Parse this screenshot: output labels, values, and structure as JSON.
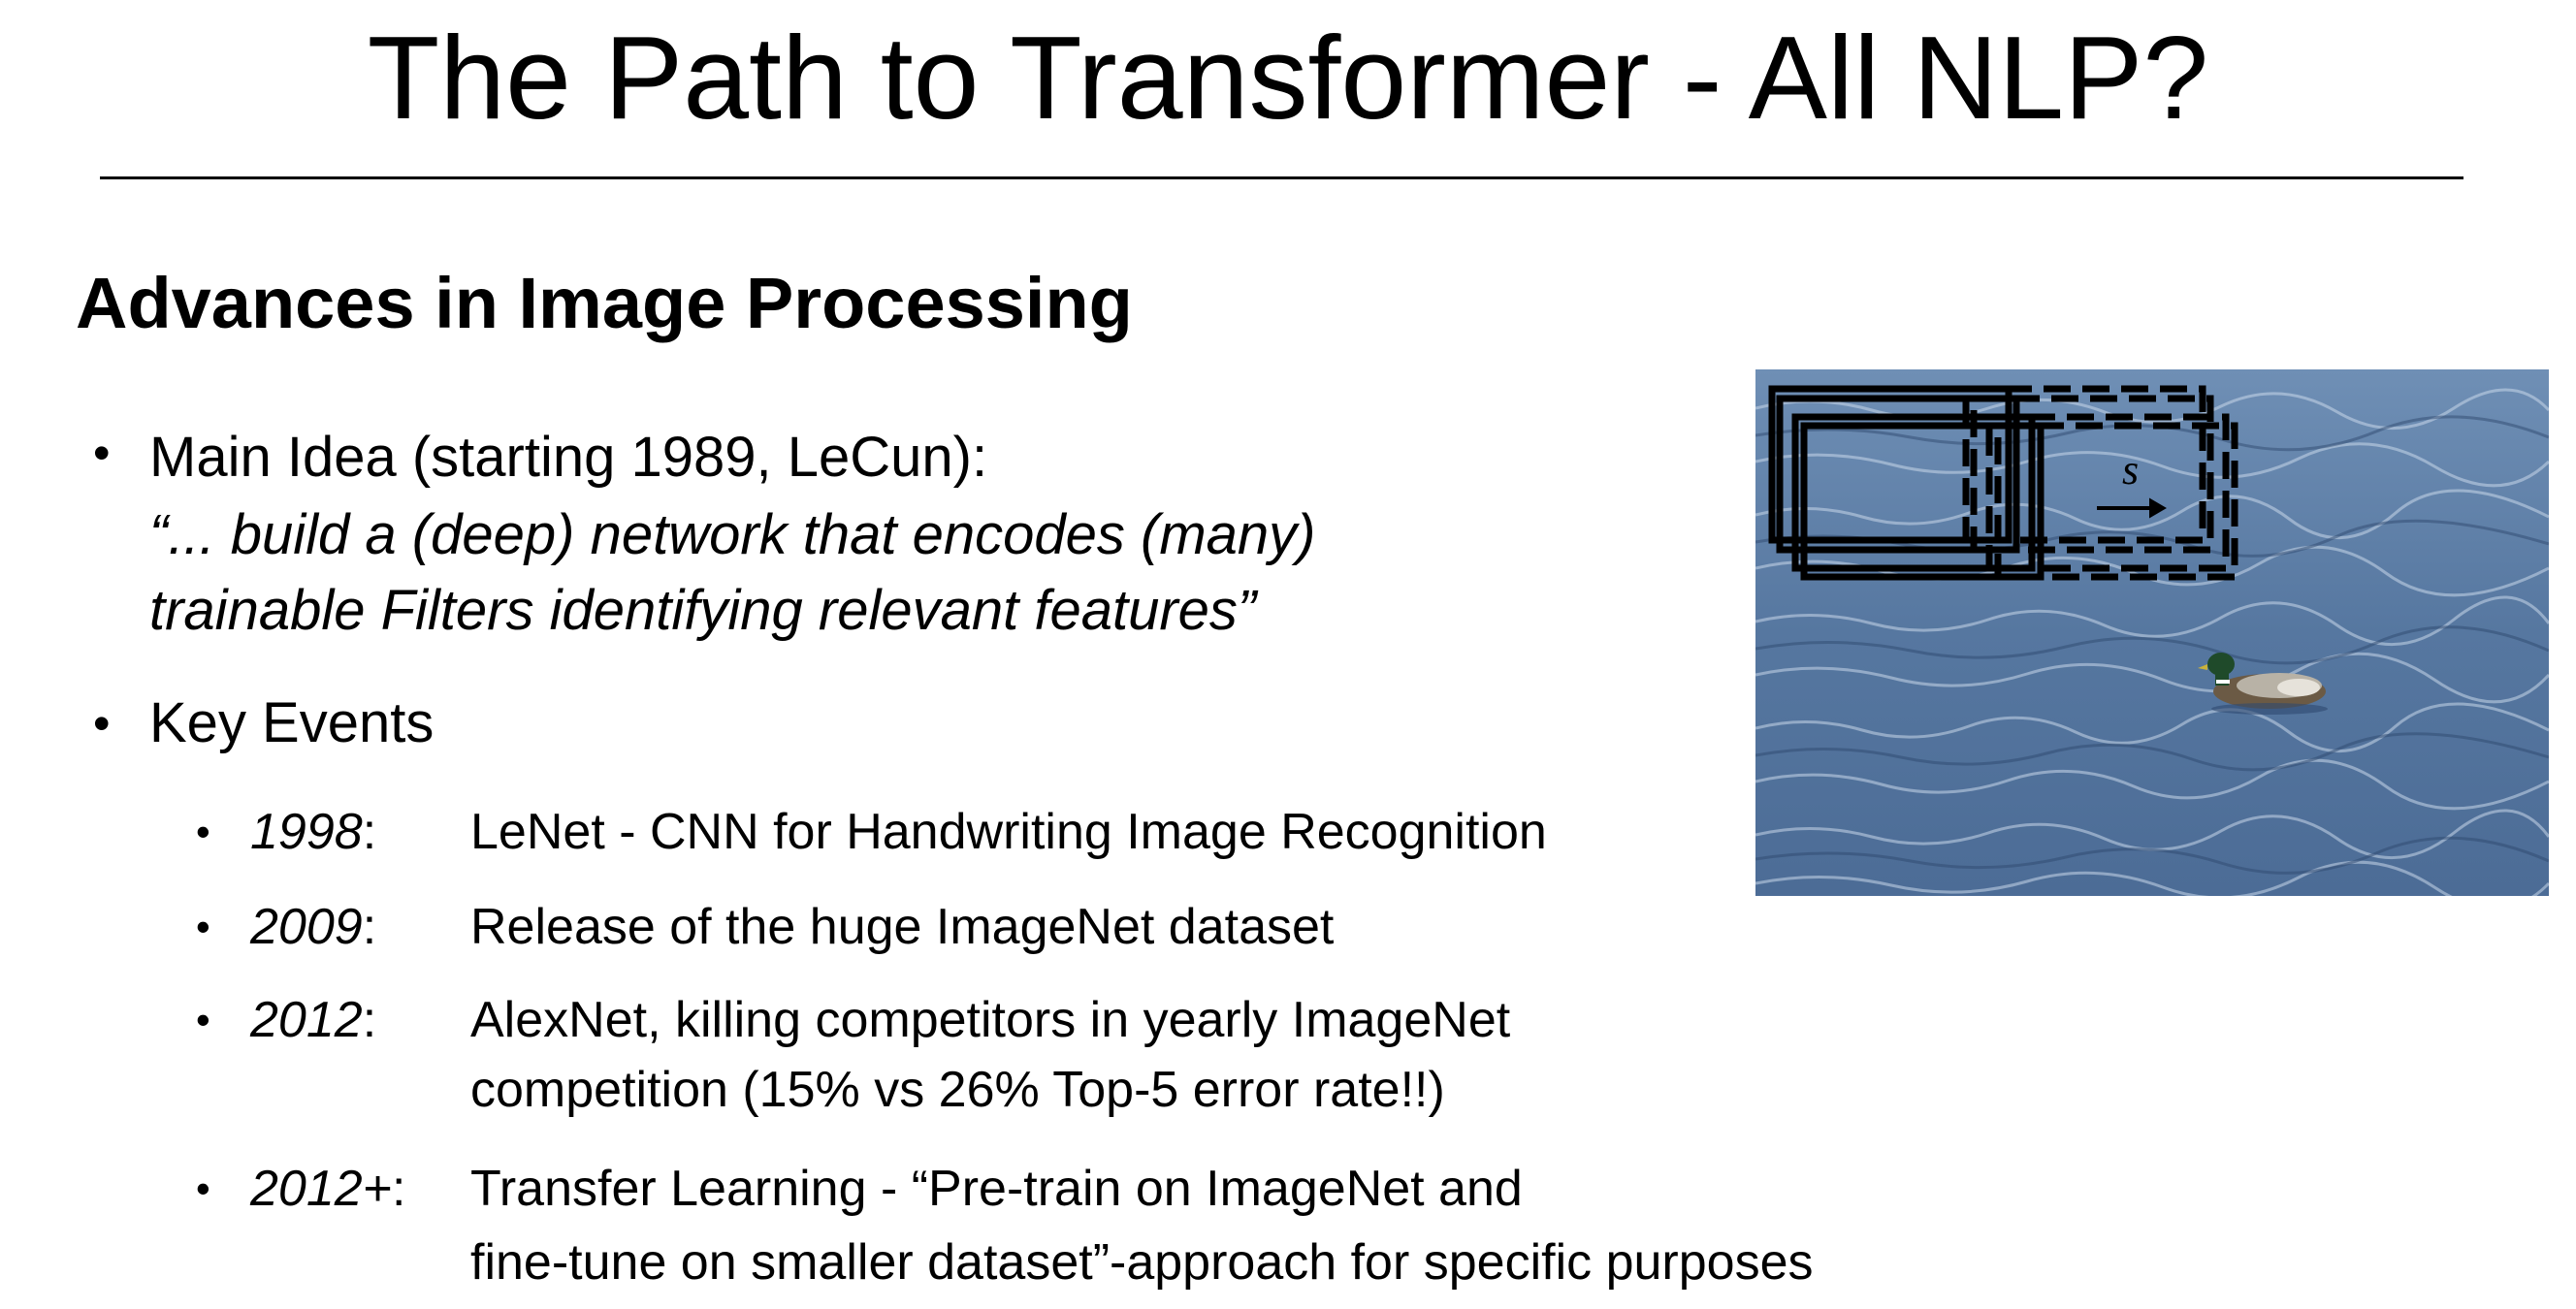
{
  "slide": {
    "title": "The Path to Transformer - All NLP?",
    "section_heading": "Advances in Image Processing",
    "main_idea": {
      "label": "Main Idea (starting 1989, LeCun):",
      "quote_line1": "“... build a (deep) network that encodes (many)",
      "quote_line2": "trainable Filters identifying relevant features”"
    },
    "key_events": {
      "label": "Key Events",
      "items": [
        {
          "year": "1998",
          "sep": ":",
          "line1": "LeNet - CNN for Handwriting Image Recognition",
          "line2": ""
        },
        {
          "year": "2009",
          "sep": ":",
          "line1": "Release of the huge ImageNet dataset",
          "line2": ""
        },
        {
          "year": "2012",
          "sep": ":",
          "line1": "AlexNet, killing competitors in yearly ImageNet",
          "line2": "competition (15% vs 26% Top-5 error rate!!)"
        },
        {
          "year": "2012+",
          "sep": ":",
          "line1": "Transfer Learning - “Pre-train on ImageNet and",
          "line2": "fine-tune on smaller dataset”-approach for specific purposes"
        }
      ]
    },
    "figure": {
      "stride_label": "s",
      "water_color": "#5b7fa8",
      "filter_color": "#000000"
    }
  }
}
